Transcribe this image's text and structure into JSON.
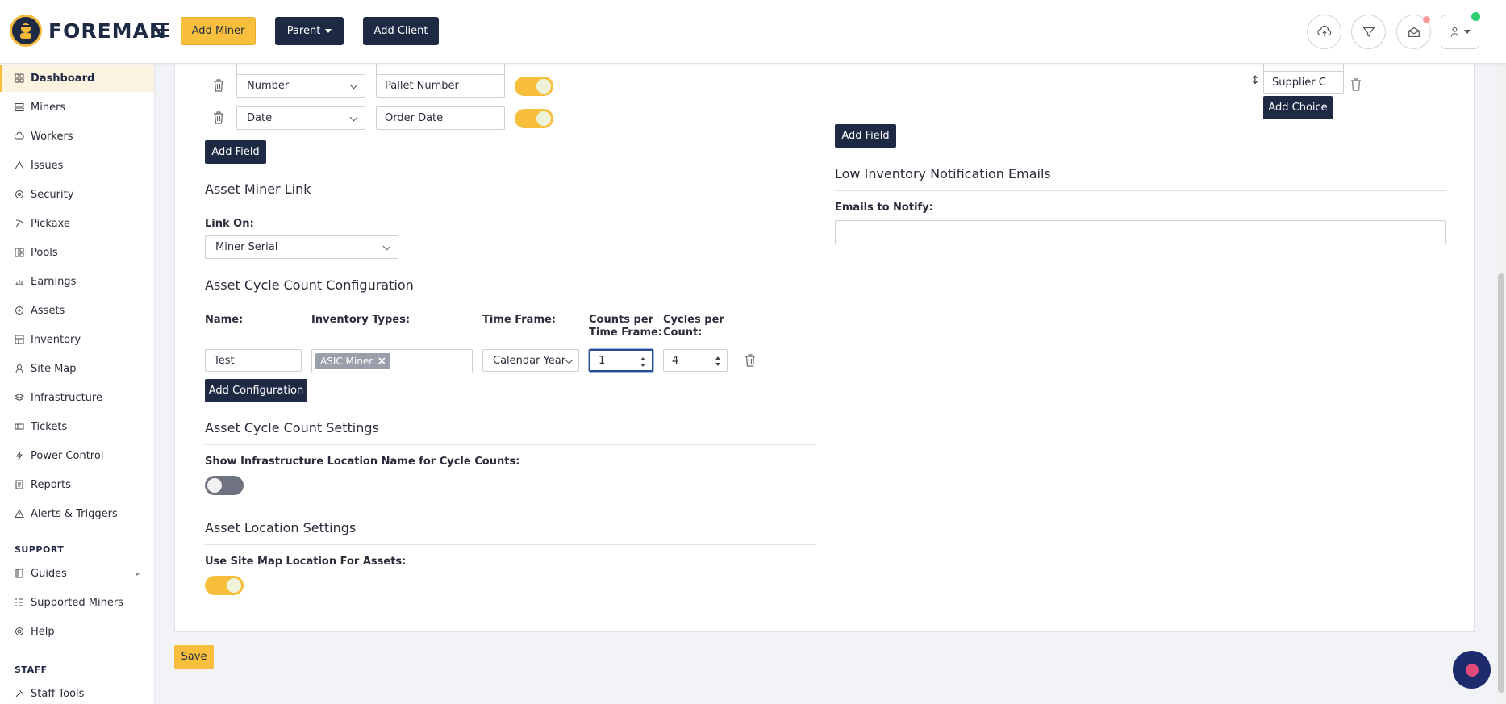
{
  "brand": {
    "name": "FOREMAN"
  },
  "header": {
    "add_miner": "Add Miner",
    "parent": "Parent",
    "add_client": "Add Client"
  },
  "colors": {
    "accent": "#f7bf3c",
    "primary": "#1e2a44",
    "online": "#2ecc71",
    "alert": "#ff6b6b"
  },
  "sidebar": {
    "items": [
      {
        "label": "Dashboard",
        "icon": "grid-icon"
      },
      {
        "label": "Miners",
        "icon": "server-icon"
      },
      {
        "label": "Workers",
        "icon": "cloud-icon"
      },
      {
        "label": "Issues",
        "icon": "warning-icon"
      },
      {
        "label": "Security",
        "icon": "shield-icon"
      },
      {
        "label": "Pickaxe",
        "icon": "pickaxe-icon"
      },
      {
        "label": "Pools",
        "icon": "pools-icon"
      },
      {
        "label": "Earnings",
        "icon": "earnings-icon"
      },
      {
        "label": "Assets",
        "icon": "asset-icon"
      },
      {
        "label": "Inventory",
        "icon": "inventory-icon"
      },
      {
        "label": "Site Map",
        "icon": "sitemap-icon"
      },
      {
        "label": "Infrastructure",
        "icon": "layers-icon"
      },
      {
        "label": "Tickets",
        "icon": "ticket-icon"
      },
      {
        "label": "Power Control",
        "icon": "bolt-icon"
      },
      {
        "label": "Reports",
        "icon": "report-icon"
      },
      {
        "label": "Alerts & Triggers",
        "icon": "alert-icon"
      }
    ],
    "support_label": "SUPPORT",
    "support_items": [
      {
        "label": "Guides",
        "icon": "book-icon"
      },
      {
        "label": "Supported Miners",
        "icon": "list-icon"
      },
      {
        "label": "Help",
        "icon": "help-icon"
      }
    ],
    "staff_label": "STAFF",
    "staff_items": [
      {
        "label": "Staff Tools",
        "icon": "tools-icon"
      }
    ]
  },
  "fields": {
    "rows": [
      {
        "type": "Number",
        "name": "Pallet Number",
        "enabled": true
      },
      {
        "type": "Date",
        "name": "Order Date",
        "enabled": true
      }
    ],
    "add_field": "Add Field"
  },
  "right_panel": {
    "choice_value": "Supplier C",
    "add_choice": "Add Choice",
    "add_field": "Add Field",
    "low_inventory_title": "Low Inventory Notification Emails",
    "emails_label": "Emails to Notify:",
    "emails_value": ""
  },
  "asset_miner_link": {
    "title": "Asset Miner Link",
    "link_on_label": "Link On:",
    "link_on_value": "Miner Serial"
  },
  "cycle_config": {
    "title": "Asset Cycle Count Configuration",
    "col_name": "Name:",
    "col_types": "Inventory Types:",
    "col_timeframe": "Time Frame:",
    "col_counts_1": "Counts per",
    "col_counts_2": "Time Frame:",
    "col_cycles_1": "Cycles per",
    "col_cycles_2": "Count:",
    "row": {
      "name": "Test",
      "type_chip": "ASIC Miner",
      "timeframe": "Calendar Year",
      "counts": "1",
      "cycles": "4"
    },
    "add_configuration": "Add Configuration"
  },
  "cycle_settings": {
    "title": "Asset Cycle Count Settings",
    "show_location_label": "Show Infrastructure Location Name for Cycle Counts:",
    "show_location_enabled": false
  },
  "location_settings": {
    "title": "Asset Location Settings",
    "use_site_map_label": "Use Site Map Location For Assets:",
    "use_site_map_enabled": true
  },
  "footer": {
    "save": "Save"
  }
}
